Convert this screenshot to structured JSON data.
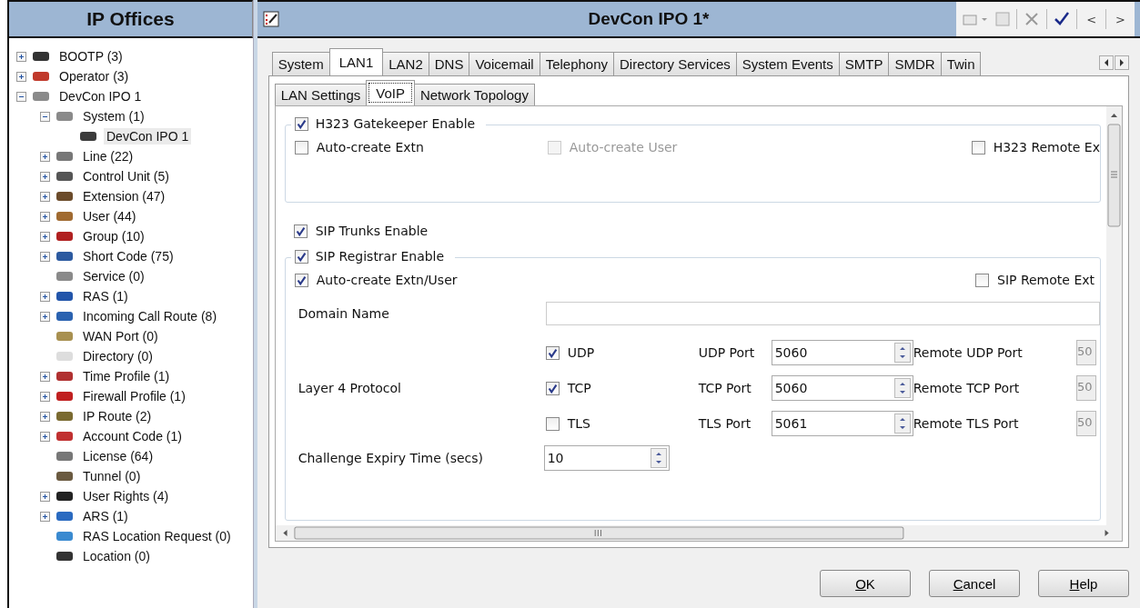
{
  "sidebar": {
    "title": "IP Offices",
    "tree": [
      {
        "label": "BOOTP (3)",
        "expanded": false,
        "selected": false
      },
      {
        "label": "Operator (3)",
        "expanded": false,
        "selected": false
      },
      {
        "label": "DevCon IPO 1",
        "expanded": true,
        "selected": false,
        "children": [
          {
            "label": "System (1)",
            "expanded": true,
            "selected": false,
            "children": [
              {
                "label": "DevCon IPO 1",
                "selected": true
              }
            ]
          },
          {
            "label": "Line (22)",
            "expanded": false,
            "selected": false
          },
          {
            "label": "Control Unit (5)",
            "expanded": false,
            "selected": false
          },
          {
            "label": "Extension (47)",
            "expanded": false,
            "selected": false
          },
          {
            "label": "User (44)",
            "expanded": false,
            "selected": false
          },
          {
            "label": "Group (10)",
            "expanded": false,
            "selected": false
          },
          {
            "label": "Short Code (75)",
            "expanded": false,
            "selected": false
          },
          {
            "label": "Service (0)",
            "selected": false
          },
          {
            "label": "RAS (1)",
            "expanded": false,
            "selected": false
          },
          {
            "label": "Incoming Call Route (8)",
            "expanded": false,
            "selected": false
          },
          {
            "label": "WAN Port (0)",
            "selected": false
          },
          {
            "label": "Directory (0)",
            "selected": false
          },
          {
            "label": "Time Profile (1)",
            "expanded": false,
            "selected": false
          },
          {
            "label": "Firewall Profile (1)",
            "expanded": false,
            "selected": false
          },
          {
            "label": "IP Route (2)",
            "expanded": false,
            "selected": false
          },
          {
            "label": "Account Code (1)",
            "expanded": false,
            "selected": false
          },
          {
            "label": "License (64)",
            "selected": false
          },
          {
            "label": "Tunnel (0)",
            "selected": false
          },
          {
            "label": "User Rights (4)",
            "expanded": false,
            "selected": false
          },
          {
            "label": "ARS (1)",
            "expanded": false,
            "selected": false
          },
          {
            "label": "RAS Location Request (0)",
            "selected": false
          },
          {
            "label": "Location (0)",
            "selected": false
          }
        ]
      }
    ]
  },
  "window": {
    "title": "DevCon IPO 1*",
    "nav": [
      "<",
      ">"
    ]
  },
  "tabs": [
    {
      "label": "System",
      "selected": false
    },
    {
      "label": "LAN1",
      "selected": true
    },
    {
      "label": "LAN2",
      "selected": false
    },
    {
      "label": "DNS",
      "selected": false
    },
    {
      "label": "Voicemail",
      "selected": false
    },
    {
      "label": "Telephony",
      "selected": false
    },
    {
      "label": "Directory Services",
      "selected": false
    },
    {
      "label": "System Events",
      "selected": false
    },
    {
      "label": "SMTP",
      "selected": false
    },
    {
      "label": "SMDR",
      "selected": false
    },
    {
      "label": "Twin",
      "selected": false
    }
  ],
  "subtabs": [
    {
      "label": "LAN Settings",
      "selected": false
    },
    {
      "label": "VoIP",
      "selected": true
    },
    {
      "label": "Network Topology",
      "selected": false
    }
  ],
  "h323": {
    "label": "H323 Gatekeeper Enable",
    "checked": true,
    "options": [
      {
        "label": "Auto-create Extn",
        "checked": false,
        "disabled": false
      },
      {
        "label": "Auto-create User",
        "checked": false,
        "disabled": true
      },
      {
        "label": "H323 Remote Ex",
        "checked": false,
        "disabled": false
      }
    ]
  },
  "sip_trunks": {
    "label": "SIP Trunks Enable",
    "checked": true
  },
  "sip_registrar": {
    "label": "SIP Registrar Enable",
    "checked": true,
    "options": [
      {
        "label": "Auto-create Extn/User",
        "checked": true
      },
      {
        "label": "SIP Remote Ext",
        "checked": false
      }
    ],
    "domain_name": {
      "label": "Domain Name"
    },
    "layer4": {
      "label": "Layer 4 Protocol",
      "protocols": [
        {
          "label": "UDP",
          "checked": true,
          "port_label": "UDP Port",
          "port": "5060",
          "remote_label": "Remote UDP Port",
          "remote": "50"
        },
        {
          "label": "TCP",
          "checked": true,
          "port_label": "TCP Port",
          "port": "5060",
          "remote_label": "Remote TCP Port",
          "remote": "50"
        },
        {
          "label": "TLS",
          "checked": false,
          "port_label": "TLS Port",
          "port": "5061",
          "remote_label": "Remote TLS Port",
          "remote": "50"
        }
      ]
    },
    "challenge": {
      "label": "Challenge Expiry Time (secs)",
      "value": "10"
    }
  },
  "buttons": [
    "OK",
    "Cancel",
    "Help"
  ]
}
